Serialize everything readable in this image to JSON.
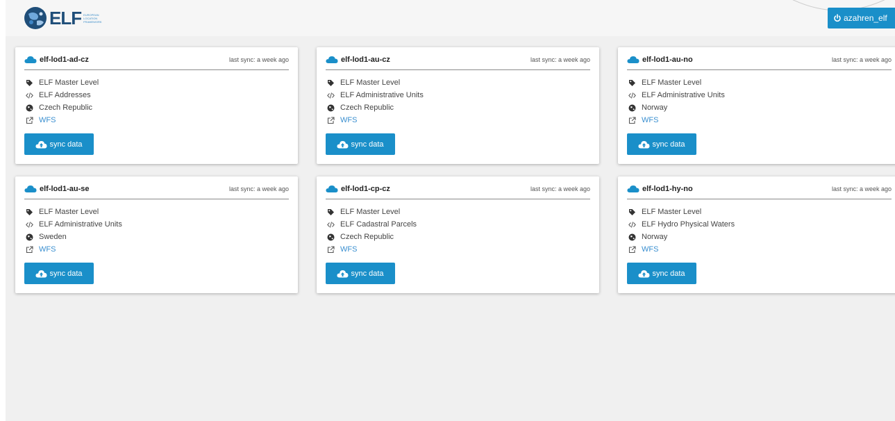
{
  "header": {
    "logo_text": "ELF",
    "logo_sub": [
      "EUROPEAN",
      "LOCATION",
      "FRAMEWORK"
    ],
    "user_label": "azahren_elf"
  },
  "colors": {
    "accent": "#1a8fc9",
    "link": "#3a8fd0",
    "cloud": "#1a8fc9"
  },
  "cards": [
    {
      "title": "elf-lod1-ad-cz",
      "sync": "last sync: a week ago",
      "level": "ELF Master Level",
      "theme": "ELF Addresses",
      "country": "Czech Republic",
      "service": "WFS",
      "button": "sync data"
    },
    {
      "title": "elf-lod1-au-cz",
      "sync": "last sync: a week ago",
      "level": "ELF Master Level",
      "theme": "ELF Administrative Units",
      "country": "Czech Republic",
      "service": "WFS",
      "button": "sync data"
    },
    {
      "title": "elf-lod1-au-no",
      "sync": "last sync: a week ago",
      "level": "ELF Master Level",
      "theme": "ELF Administrative Units",
      "country": "Norway",
      "service": "WFS",
      "button": "sync data"
    },
    {
      "title": "elf-lod1-au-se",
      "sync": "last sync: a week ago",
      "level": "ELF Master Level",
      "theme": "ELF Administrative Units",
      "country": "Sweden",
      "service": "WFS",
      "button": "sync data"
    },
    {
      "title": "elf-lod1-cp-cz",
      "sync": "last sync: a week ago",
      "level": "ELF Master Level",
      "theme": "ELF Cadastral Parcels",
      "country": "Czech Republic",
      "service": "WFS",
      "button": "sync data"
    },
    {
      "title": "elf-lod1-hy-no",
      "sync": "last sync: a week ago",
      "level": "ELF Master Level",
      "theme": "ELF Hydro Physical Waters",
      "country": "Norway",
      "service": "WFS",
      "button": "sync data"
    }
  ]
}
